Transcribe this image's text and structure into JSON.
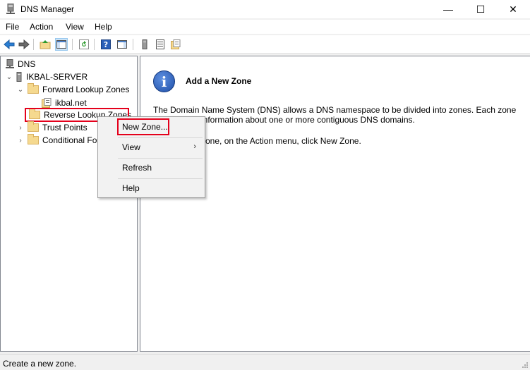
{
  "window": {
    "title": "DNS Manager",
    "min": "—",
    "max": "☐",
    "close": "✕"
  },
  "menu": [
    "File",
    "Action",
    "View",
    "Help"
  ],
  "tree": {
    "root": "DNS",
    "server": "IKBAL-SERVER",
    "forward": "Forward Lookup Zones",
    "zone_ikbal": "ikbal.net",
    "reverse": "Reverse Lookup Zones",
    "trust": "Trust Points",
    "conditional": "Conditional Fo"
  },
  "context_menu": {
    "new_zone": "New Zone...",
    "view": "View",
    "view_arrow": "›",
    "refresh": "Refresh",
    "help": "Help"
  },
  "content": {
    "heading": "Add a New Zone",
    "line1": "The Domain Name System (DNS) allows a DNS namespace to be divided into zones. Each zone",
    "line2": "information about one or more contiguous DNS domains.",
    "line3": "zone, on the Action menu, click New Zone."
  },
  "status": "Create a new zone.",
  "colors": {
    "highlight": "#e4001b",
    "accent": "#1f4fa8"
  }
}
